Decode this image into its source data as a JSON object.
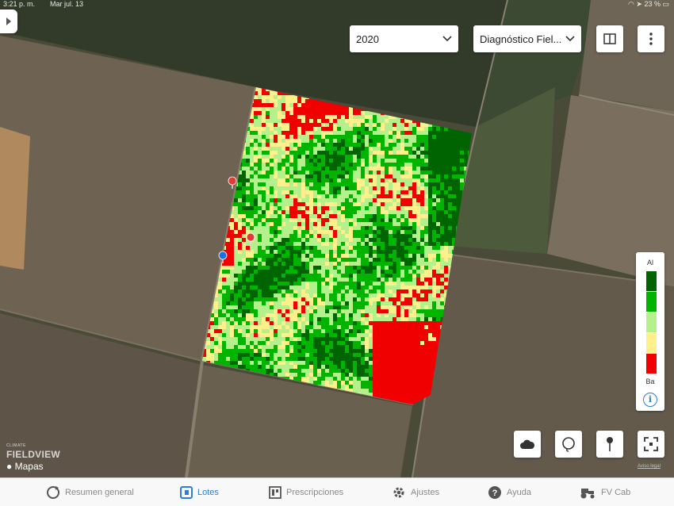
{
  "status": {
    "time": "3:21 p. m.",
    "date": "Mar jul. 13",
    "battery": "23 %"
  },
  "toolbar": {
    "year": "2020",
    "layer": "Diagnóstico Fiel..."
  },
  "legend": {
    "top_label": "Al",
    "bottom_label": "Ba",
    "colors": [
      "#006400",
      "#00b400",
      "#b4f08c",
      "#fff08c",
      "#f00000"
    ]
  },
  "branding": {
    "climate": "CLIMATE",
    "fieldview": "FIELDVIEW",
    "maps": "Mapas",
    "legal": "Aviso legal"
  },
  "map": {
    "pins": [
      {
        "name": "pin-red-1",
        "color": "#e53935"
      },
      {
        "name": "pin-red-2",
        "color": "#e53935"
      },
      {
        "name": "pin-blue",
        "color": "#1e6fe0"
      }
    ]
  },
  "tabs": [
    {
      "label": "Resumen general",
      "icon": "loop-icon",
      "active": false
    },
    {
      "label": "Lotes",
      "icon": "field-icon",
      "active": true
    },
    {
      "label": "Prescripciones",
      "icon": "prescription-icon",
      "active": false
    },
    {
      "label": "Ajustes",
      "icon": "gear-icon",
      "active": false
    },
    {
      "label": "Ayuda",
      "icon": "help-icon",
      "active": false
    },
    {
      "label": "FV Cab",
      "icon": "tractor-icon",
      "active": false
    }
  ]
}
